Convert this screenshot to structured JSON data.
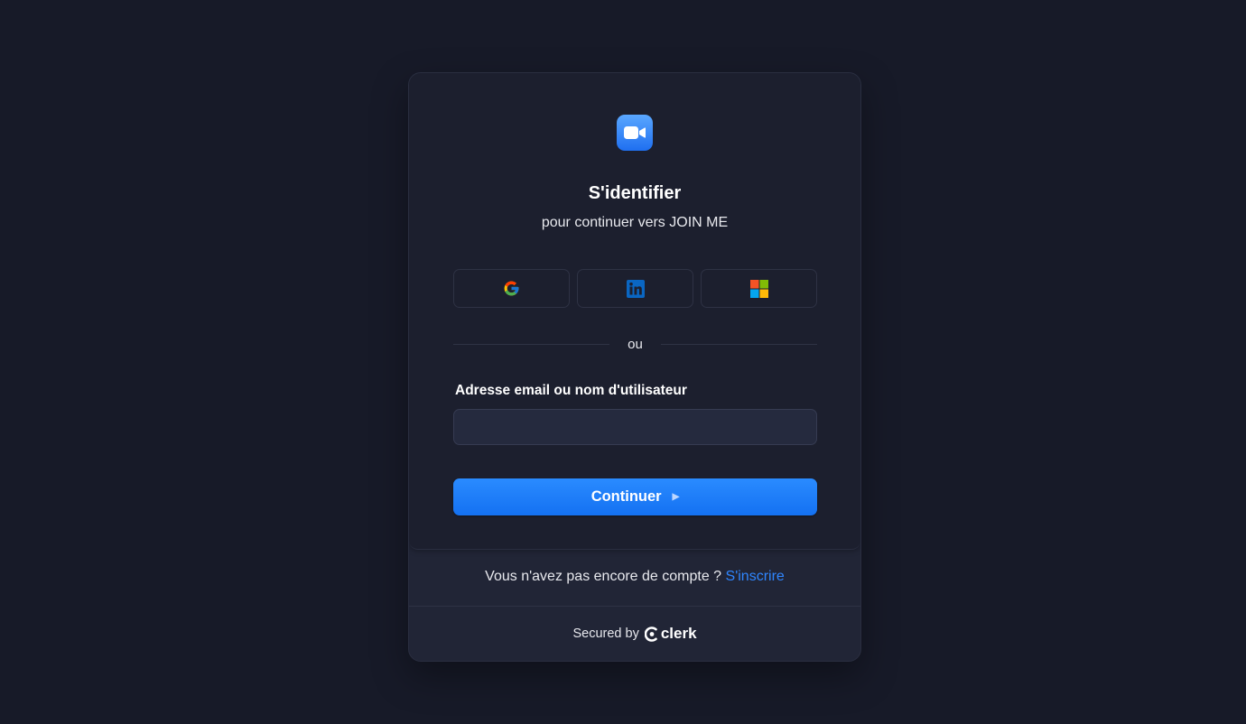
{
  "app": {
    "logo_icon": "video-camera-icon",
    "title": "S'identifier",
    "subtitle": "pour continuer vers JOIN ME"
  },
  "social": {
    "providers": [
      {
        "name": "Google",
        "icon": "google-icon"
      },
      {
        "name": "LinkedIn",
        "icon": "linkedin-icon"
      },
      {
        "name": "Microsoft",
        "icon": "microsoft-icon"
      }
    ]
  },
  "divider": {
    "text": "ou"
  },
  "form": {
    "email_label": "Adresse email ou nom d'utilisateur",
    "email_value": "",
    "continue_label": "Continuer"
  },
  "signup": {
    "prompt": "Vous n'avez pas encore de compte ?",
    "link": "S'inscrire"
  },
  "footer": {
    "secured_by": "Secured by",
    "brand": "clerk"
  },
  "colors": {
    "background": "#171a28",
    "card": "#1c1f2e",
    "accent": "#1a7cff",
    "link": "#2f86ff"
  }
}
